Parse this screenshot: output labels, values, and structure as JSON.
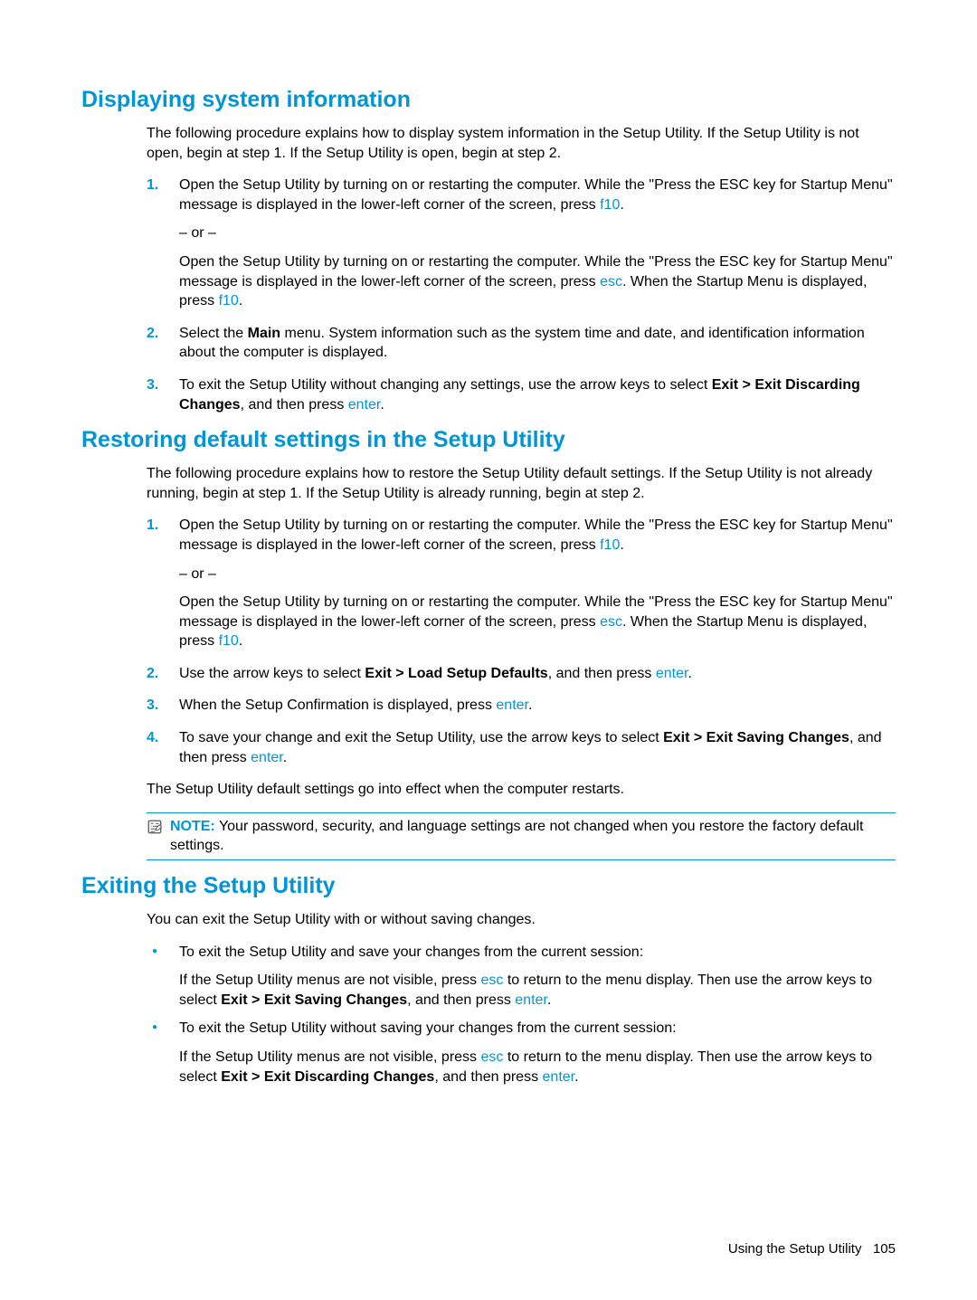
{
  "sections": {
    "s1": {
      "heading": "Displaying system information",
      "intro": "The following procedure explains how to display system information in the Setup Utility. If the Setup Utility is not open, begin at step 1. If the Setup Utility is open, begin at step 2.",
      "steps": {
        "n1": "1.",
        "st1a": "Open the Setup Utility by turning on or restarting the computer. While the \"Press the ESC key for Startup Menu\" message is displayed in the lower-left corner of the screen, press ",
        "st1a_key": "f10",
        "st1a_end": ".",
        "or": "– or –",
        "st1b_a": "Open the Setup Utility by turning on or restarting the computer. While the \"Press the ESC key for Startup Menu\" message is displayed in the lower-left corner of the screen, press ",
        "st1b_key1": "esc",
        "st1b_mid": ". When the Startup Menu is displayed, press ",
        "st1b_key2": "f10",
        "st1b_end": ".",
        "n2": "2.",
        "st2a": "Select the ",
        "st2b": "Main",
        "st2c": " menu. System information such as the system time and date, and identification information about the computer is displayed.",
        "n3": "3.",
        "st3a": "To exit the Setup Utility without changing any settings, use the arrow keys to select ",
        "st3b": "Exit > Exit Discarding Changes",
        "st3c": ", and then press ",
        "st3key": "enter",
        "st3end": "."
      }
    },
    "s2": {
      "heading": "Restoring default settings in the Setup Utility",
      "intro": "The following procedure explains how to restore the Setup Utility default settings. If the Setup Utility is not already running, begin at step 1. If the Setup Utility is already running, begin at step 2.",
      "steps": {
        "n1": "1.",
        "st1a": "Open the Setup Utility by turning on or restarting the computer. While the \"Press the ESC key for Startup Menu\" message is displayed in the lower-left corner of the screen, press ",
        "st1a_key": "f10",
        "st1a_end": ".",
        "or": "– or –",
        "st1b_a": "Open the Setup Utility by turning on or restarting the computer. While the \"Press the ESC key for Startup Menu\" message is displayed in the lower-left corner of the screen, press ",
        "st1b_key1": "esc",
        "st1b_mid": ". When the Startup Menu is displayed, press ",
        "st1b_key2": "f10",
        "st1b_end": ".",
        "n2": "2.",
        "st2a": "Use the arrow keys to select ",
        "st2b": "Exit > Load Setup Defaults",
        "st2c": ", and then press ",
        "st2key": "enter",
        "st2end": ".",
        "n3": "3.",
        "st3a": "When the Setup Confirmation is displayed, press ",
        "st3key": "enter",
        "st3end": ".",
        "n4": "4.",
        "st4a": "To save your change and exit the Setup Utility, use the arrow keys to select ",
        "st4b": "Exit > Exit Saving Changes",
        "st4c": ", and then press ",
        "st4key": "enter",
        "st4end": "."
      },
      "after": "The Setup Utility default settings go into effect when the computer restarts.",
      "note": {
        "label": "NOTE:",
        "text": "Your password, security, and language settings are not changed when you restore the factory default settings."
      }
    },
    "s3": {
      "heading": "Exiting the Setup Utility",
      "intro": "You can exit the Setup Utility with or without saving changes.",
      "b1": {
        "lead": "To exit the Setup Utility and save your changes from the current session:",
        "p_a": "If the Setup Utility menus are not visible, press ",
        "p_key1": "esc",
        "p_mid": " to return to the menu display. Then use the arrow keys to select ",
        "p_bold": "Exit > Exit Saving Changes",
        "p_c": ", and then press ",
        "p_key2": "enter",
        "p_end": "."
      },
      "b2": {
        "lead": "To exit the Setup Utility without saving your changes from the current session:",
        "p_a": "If the Setup Utility menus are not visible, press ",
        "p_key1": "esc",
        "p_mid": " to return to the menu display. Then use the arrow keys to select ",
        "p_bold": "Exit > Exit Discarding Changes",
        "p_c": ", and then press ",
        "p_key2": "enter",
        "p_end": "."
      }
    }
  },
  "footer": {
    "text": "Using the Setup Utility",
    "page": "105"
  }
}
